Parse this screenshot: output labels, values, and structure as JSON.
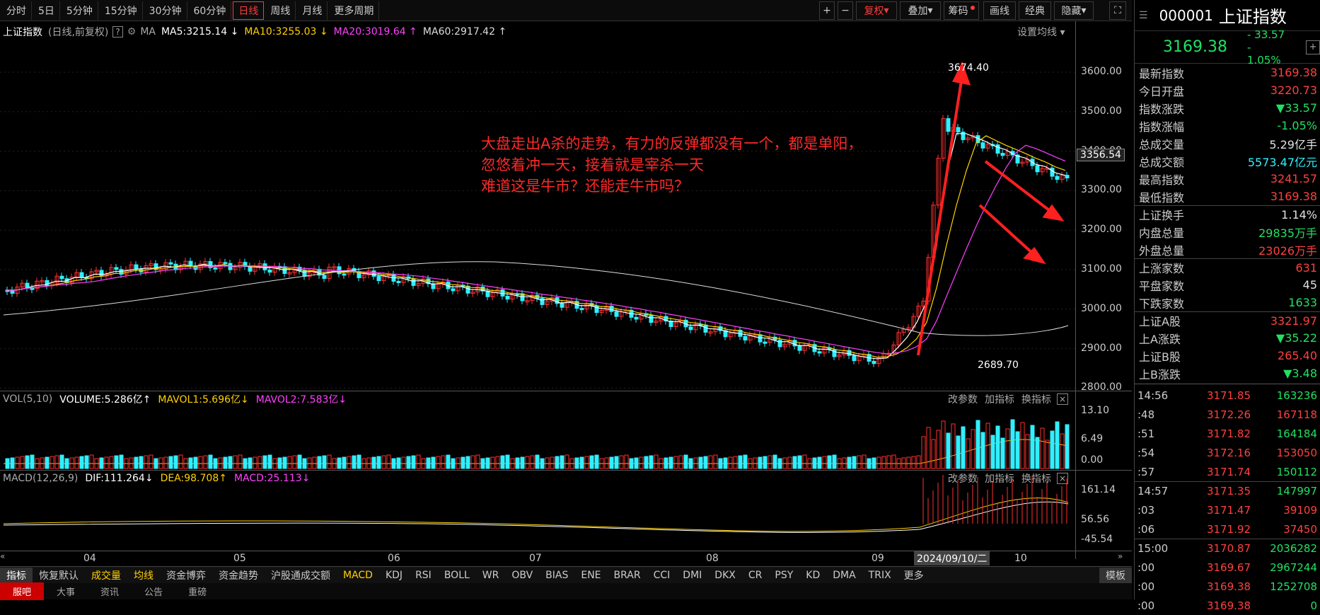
{
  "toolbar": {
    "periods": [
      "分时",
      "5日",
      "5分钟",
      "15分钟",
      "30分钟",
      "60分钟",
      "日线",
      "周线",
      "月线",
      "更多周期"
    ],
    "active_period": "日线",
    "plus": "+",
    "minus": "−",
    "fuquan": "复权",
    "overlay": "叠加",
    "chips": "筹码",
    "draw": "画线",
    "classic": "经典",
    "hide": "隐藏",
    "expand": "⛶"
  },
  "ma_line": {
    "index_name": "上证指数",
    "meta": "(日线,前复权)",
    "help": "?",
    "ma_label": "MA",
    "ma5": "MA5:3215.14",
    "ma10": "MA10:3255.03",
    "ma20": "MA20:3019.64",
    "ma60": "MA60:2917.42",
    "settings": "设置均线"
  },
  "price_axis": [
    "3600.00",
    "3500.00",
    "3400.00",
    "3300.00",
    "3200.00",
    "3100.00",
    "3000.00",
    "2900.00",
    "2800.00"
  ],
  "current_price_tag": "3356.54",
  "annotations": {
    "high": "3674.40",
    "low": "2689.70",
    "text_line1": "大盘走出A杀的走势，有力的反弹都没有一个，都是单阳，",
    "text_line2": "忽悠着冲一天，接着就是宰杀一天",
    "text_line3": "难道这是牛市？还能走牛市吗？"
  },
  "vol_panel": {
    "label": "VOL(5,10)",
    "volume": "VOLUME:5.286亿",
    "mavol1": "MAVOL1:5.696亿",
    "mavol2": "MAVOL2:7.583亿",
    "axis": [
      "13.10",
      "6.49",
      "0.00"
    ],
    "btn1": "改参数",
    "btn2": "加指标",
    "btn3": "换指标",
    "close": "×"
  },
  "macd_panel": {
    "label": "MACD(12,26,9)",
    "dif": "DIF:111.264",
    "dea": "DEA:98.708",
    "macd": "MACD:25.113",
    "axis": [
      "161.14",
      "56.56",
      "-45.54"
    ],
    "btn1": "改参数",
    "btn2": "加指标",
    "btn3": "换指标",
    "close": "×"
  },
  "x_axis": [
    "04",
    "05",
    "06",
    "07",
    "08",
    "09",
    "10"
  ],
  "cursor_date": "2024/09/10/二",
  "indicators": [
    "指标",
    "恢复默认",
    "成交量",
    "均线",
    "资金博弈",
    "资金趋势",
    "沪股通成交额",
    "MACD",
    "KDJ",
    "RSI",
    "BOLL",
    "WR",
    "OBV",
    "BIAS",
    "ENE",
    "BRAR",
    "CCI",
    "DMI",
    "DKX",
    "CR",
    "PSY",
    "KD",
    "DMA",
    "TRIX",
    "更多",
    "模板"
  ],
  "bottom_tabs": [
    "服吧",
    "大事",
    "资讯",
    "公告",
    "重磅"
  ],
  "side": {
    "code": "000001",
    "name": "上证指数",
    "price": "3169.38",
    "change": "- 33.57",
    "change_pct": "- 1.05%",
    "stats": [
      {
        "label": "最新指数",
        "value": "3169.38",
        "color": "red"
      },
      {
        "label": "今日开盘",
        "value": "3220.73",
        "color": "red"
      },
      {
        "label": "指数涨跌",
        "value": "▼33.57",
        "color": "green"
      },
      {
        "label": "指数涨幅",
        "value": "-1.05%",
        "color": "green"
      },
      {
        "label": "总成交量",
        "value": "5.29亿手",
        "color": "white"
      },
      {
        "label": "总成交额",
        "value": "5573.47亿元",
        "color": "cyan"
      },
      {
        "label": "最高指数",
        "value": "3241.57",
        "color": "red"
      },
      {
        "label": "最低指数",
        "value": "3169.38",
        "color": "red"
      },
      {
        "label": "上证换手",
        "value": "1.14%",
        "color": "white"
      },
      {
        "label": "内盘总量",
        "value": "29835万手",
        "color": "green"
      },
      {
        "label": "外盘总量",
        "value": "23026万手",
        "color": "red"
      },
      {
        "label": "上涨家数",
        "value": "631",
        "color": "red"
      },
      {
        "label": "平盘家数",
        "value": "45",
        "color": "white"
      },
      {
        "label": "下跌家数",
        "value": "1633",
        "color": "green"
      },
      {
        "label": "上证A股",
        "value": "3321.97",
        "color": "red"
      },
      {
        "label": "上A涨跌",
        "value": "▼35.22",
        "color": "green"
      },
      {
        "label": "上证B股",
        "value": "265.40",
        "color": "red"
      },
      {
        "label": "上B涨跌",
        "value": "▼3.48",
        "color": "green"
      }
    ],
    "ticks": [
      {
        "time": "14:56",
        "price": "3171.85",
        "vol": "163236",
        "vc": "green"
      },
      {
        "time": ":48",
        "price": "3172.26",
        "vol": "167118",
        "vc": "red"
      },
      {
        "time": ":51",
        "price": "3171.82",
        "vol": "164184",
        "vc": "green"
      },
      {
        "time": ":54",
        "price": "3172.16",
        "vol": "153050",
        "vc": "red"
      },
      {
        "time": ":57",
        "price": "3171.74",
        "vol": "150112",
        "vc": "green"
      },
      {
        "time": "14:57",
        "price": "3171.35",
        "vol": "147997",
        "vc": "green"
      },
      {
        "time": ":03",
        "price": "3171.47",
        "vol": "39109",
        "vc": "red"
      },
      {
        "time": ":06",
        "price": "3171.92",
        "vol": "37450",
        "vc": "red"
      },
      {
        "time": "15:00",
        "price": "3170.87",
        "vol": "2036282",
        "vc": "green"
      },
      {
        "time": ":00",
        "price": "3169.67",
        "vol": "2967244",
        "vc": "green"
      },
      {
        "time": ":00",
        "price": "3169.38",
        "vol": "1252708",
        "vc": "green"
      },
      {
        "time": ":00",
        "price": "3169.38",
        "vol": "0",
        "vc": "green"
      }
    ]
  }
}
